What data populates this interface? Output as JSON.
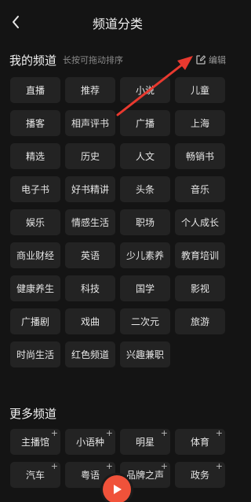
{
  "header": {
    "title": "频道分类"
  },
  "my_channels": {
    "title": "我的频道",
    "hint": "长按可拖动排序",
    "edit_label": "编辑",
    "items": [
      "直播",
      "推荐",
      "小说",
      "儿童",
      "播客",
      "相声评书",
      "广播",
      "上海",
      "精选",
      "历史",
      "人文",
      "畅销书",
      "电子书",
      "好书精讲",
      "头条",
      "音乐",
      "娱乐",
      "情感生活",
      "职场",
      "个人成长",
      "商业财经",
      "英语",
      "少儿素养",
      "教育培训",
      "健康养生",
      "科技",
      "国学",
      "影视",
      "广播剧",
      "戏曲",
      "二次元",
      "旅游",
      "时尚生活",
      "红色频道",
      "兴趣兼职"
    ]
  },
  "more_channels": {
    "title": "更多频道",
    "items": [
      "主播馆",
      "小语种",
      "明星",
      "体育",
      "汽车",
      "粤语",
      "品牌之声",
      "政务"
    ]
  },
  "colors": {
    "accent": "#f0523a",
    "background": "#141414",
    "chip": "#232323"
  },
  "icons": {
    "back": "chevron-left-icon",
    "edit": "edit-icon",
    "add": "plus-icon",
    "play": "play-icon"
  }
}
